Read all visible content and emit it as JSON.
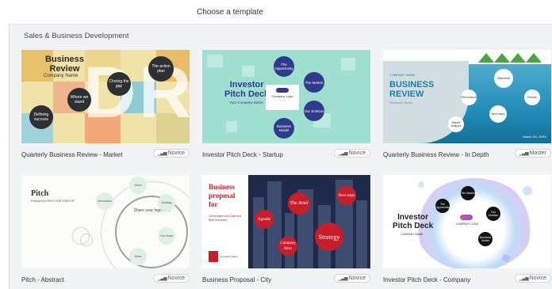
{
  "header": {
    "title": "Choose a template"
  },
  "section": {
    "title": "Sales & Business Development"
  },
  "templates": [
    {
      "title": "Quarterly Business Review - Market",
      "level": "Novice",
      "thumb": {
        "title_line1": "Business",
        "title_line2": "Review",
        "subtitle": "Company Name",
        "letters": [
          "D",
          "R"
        ],
        "circles": [
          "Closing the gap",
          "The action plan",
          "Where we stand",
          "Defining success"
        ]
      }
    },
    {
      "title": "Investor Pitch Deck - Startup",
      "level": "Novice",
      "thumb": {
        "title_line1": "Investor",
        "title_line2": "Pitch Deck",
        "subtitle": "Your Company Name",
        "logo": "Company Logo",
        "circles": [
          "The Opportunity",
          "The Market",
          "Our Solution",
          "Business Model"
        ]
      }
    },
    {
      "title": "Quarterly Business Review - In Depth",
      "level": "Master",
      "thumb": {
        "pretitle": "COMPANY NAME",
        "title_line1": "BUSINESS",
        "title_line2": "REVIEW",
        "subtitle": "Presenter Name",
        "circles": [
          "Objectives",
          "Performance",
          "Results",
          "Next steps",
          "Market analysis"
        ],
        "corner": "March XX, 20XX"
      }
    },
    {
      "title": "Pitch - Abstract",
      "level": "Novice",
      "thumb": {
        "title": "Pitch",
        "subtitle": "Powered by PREZI FOR STARTUP",
        "center": "Share your logo here",
        "nodes": [
          "Vision",
          "Introduction",
          "Strategy",
          "Our Goals",
          "Week"
        ]
      }
    },
    {
      "title": "Business Proposal - City",
      "level": "Novice",
      "thumb": {
        "title_line1": "Business",
        "title_line2": "proposal",
        "title_line3": "for",
        "subtitle": "Client Name and Date and Brief Summary",
        "footer": "Company Name",
        "circles": [
          "The Brief",
          "Next steps",
          "Agenda",
          "Strategy",
          "Company Intro"
        ]
      }
    },
    {
      "title": "Investor Pitch Deck - Company",
      "level": "Novice",
      "thumb": {
        "title_line1": "Investor",
        "title_line2": "Pitch Deck",
        "subtitle": "COMPANY NAME",
        "logo": "COMPANY LOGO",
        "dots": [
          "The Market",
          "Our Solution",
          "The Opportunity",
          "Business Model"
        ]
      }
    }
  ],
  "colors": {
    "panel": "#f1f3f5",
    "prezi_blue": "#2f3a8c",
    "proposal_red": "#c81e2a"
  }
}
